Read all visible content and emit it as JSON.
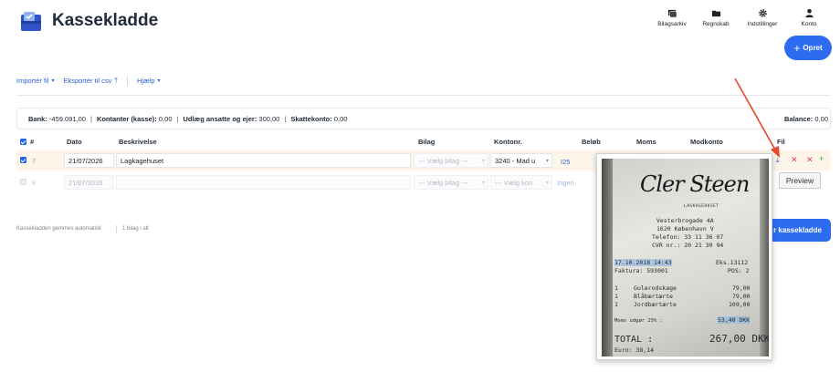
{
  "header": {
    "app_title": "Kassekladde",
    "nav": [
      {
        "label": "Bilagsarkiv",
        "icon": "photo-stack-icon"
      },
      {
        "label": "Regnskab",
        "icon": "folder-icon"
      },
      {
        "label": "Indstillinger",
        "icon": "gear-icon"
      },
      {
        "label": "Konto",
        "icon": "user-icon"
      }
    ],
    "create_label": "Opret"
  },
  "toolbar": {
    "import_label": "Importér fil",
    "export_label": "Eksportér til csv",
    "help_label": "Hjælp"
  },
  "summary": {
    "bank_label": "Bank:",
    "bank_value": "-459.091,00",
    "cash_label": "Kontanter (kasse):",
    "cash_value": "0,00",
    "expense_label": "Udlæg ansatte og ejer:",
    "expense_value": "300,00",
    "tax_label": "Skattekonto:",
    "tax_value": "0,00",
    "balance_label": "Balance:",
    "balance_value": "0,00"
  },
  "table": {
    "headers": {
      "num": "#",
      "date": "Dato",
      "desc": "Beskrivelse",
      "voucher": "Bilag",
      "account": "Kontonr.",
      "amount": "Beløb",
      "vat": "Moms",
      "contra": "Modkonto",
      "file": "Fil"
    },
    "rows": [
      {
        "num": "7",
        "date": "21/07/2026",
        "desc": "Lagkagehuset",
        "voucher": "--- Vælg bilag ---",
        "account": "3240 - Mad u",
        "link": "I25"
      },
      {
        "num": "8",
        "date": "21/07/2026",
        "desc": "",
        "voucher": "--- Vælg bilag ---",
        "account": "--- Vælg kon",
        "link": "Ingen"
      }
    ]
  },
  "tooltip": {
    "preview_label": "Preview"
  },
  "footer": {
    "autosave_note": "Kassekladden gemmes automatisk",
    "count_note": "1 bilag i alt",
    "save_label": "r kassekladde"
  },
  "receipt": {
    "signature": "Cler Steen",
    "store": "LAGKAGEHUSET",
    "address1": "Vesterbrogade 4A",
    "address2": "1620 København V",
    "phone": "Telefon: 33 11 36 07",
    "cvr": "CVR nr.: 20 21 30 94",
    "datetime": "17.10.2018 14:43",
    "invoice": "Faktura: 593001",
    "eks": "Eks.13112",
    "pos": "POS: 2",
    "items": [
      {
        "qty": "1",
        "name": "Gulerodskage",
        "price": "79,00"
      },
      {
        "qty": "1",
        "name": "Blåbærtærte",
        "price": "79,00"
      },
      {
        "qty": "1",
        "name": "Jordbærtærte",
        "price": "109,00"
      }
    ],
    "vat_label": "Moms udgør 25% :",
    "vat_value": "53,40 DKK",
    "total_label": "TOTAL :",
    "total_value": "267,00 DKK",
    "euro": "Euro: 38,14"
  },
  "colors": {
    "accent": "#2d6cf0",
    "row_highlight": "#fdf5e7",
    "delete": "#e0424a",
    "add": "#3aa55a",
    "annotation_arrow": "#e8462b"
  }
}
